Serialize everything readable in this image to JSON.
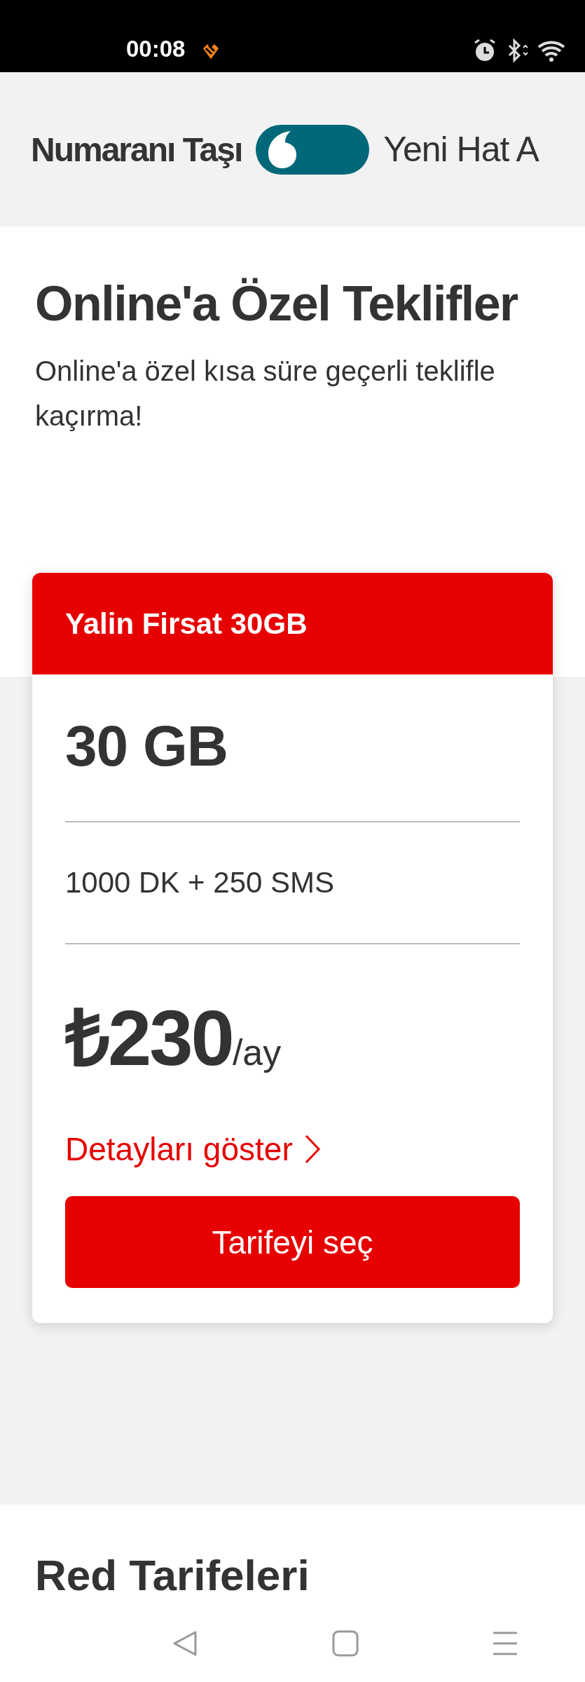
{
  "status_bar": {
    "time": "00:08"
  },
  "switcher": {
    "left_label": "Numaranı Taşı",
    "right_label": "Yeni Hat A",
    "on": false
  },
  "offers": {
    "title": "Online'a Özel Teklifler",
    "description_lines": [
      "Online'a özel kısa süre geçerli teklifle",
      "kaçırma!"
    ]
  },
  "card": {
    "header": "Yalin Firsat 30GB",
    "data": "30 GB",
    "minutes_sms": "1000 DK + 250 SMS",
    "currency": "₺",
    "price": "230",
    "period": "/ay",
    "details_link": "Detayları göster",
    "button": "Tarifeyi seç"
  },
  "next_section": {
    "title": "Red Tarifeleri"
  }
}
